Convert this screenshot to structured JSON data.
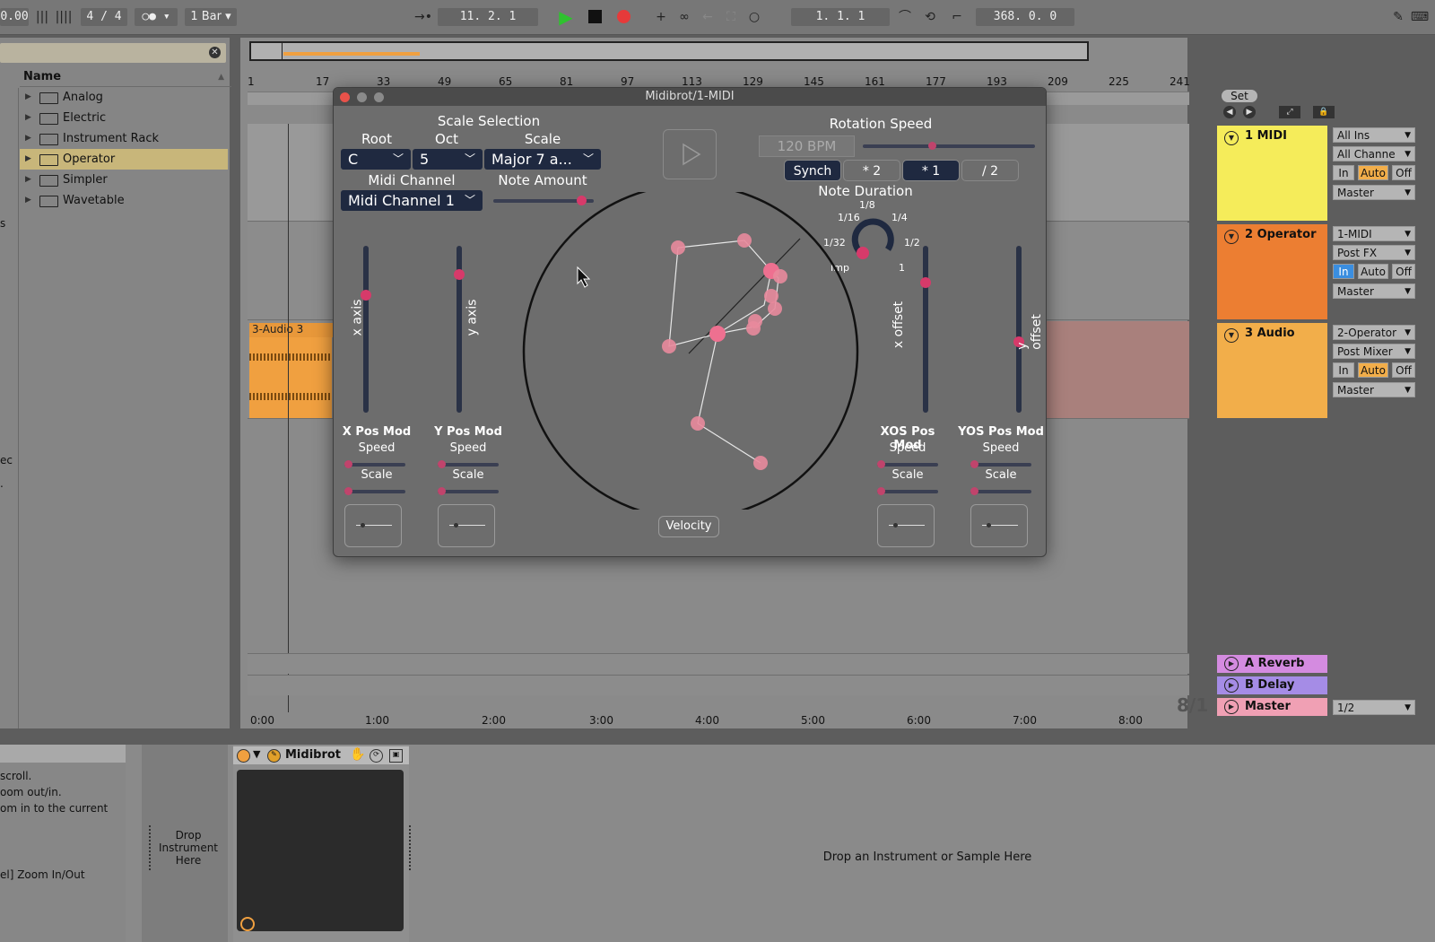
{
  "transport": {
    "tempo_fragment": "0.00",
    "signature": "4 / 4",
    "quantize": "1 Bar",
    "arrangement_position": "11.  2.  1",
    "loop_start": "1.  1.  1",
    "loop_length": "368.  0.  0"
  },
  "browser": {
    "header": "Name",
    "items": [
      {
        "label": "Analog"
      },
      {
        "label": "Electric"
      },
      {
        "label": "Instrument Rack"
      },
      {
        "label": "Operator"
      },
      {
        "label": "Simpler"
      },
      {
        "label": "Wavetable"
      }
    ],
    "side_fragments": [
      "s",
      "ec",
      "."
    ]
  },
  "ruler": {
    "bars": [
      "1",
      "17",
      "33",
      "49",
      "65",
      "81",
      "97",
      "113",
      "129",
      "145",
      "161",
      "177",
      "193",
      "209",
      "225",
      "241"
    ],
    "times": [
      "0:00",
      "1:00",
      "2:00",
      "3:00",
      "4:00",
      "5:00",
      "6:00",
      "7:00",
      "8:00"
    ],
    "zoom_fraction": "8/1"
  },
  "clip": {
    "name": "3-Audio 3"
  },
  "plugin": {
    "title": "Midibrot/1-MIDI",
    "scale_selection": "Scale Selection",
    "root_label": "Root",
    "oct_label": "Oct",
    "scale_label": "Scale",
    "root_value": "C",
    "oct_value": "5",
    "scale_value": "Major 7 a...",
    "midi_channel_label": "Midi Channel",
    "midi_channel_value": "Midi Channel 1",
    "note_amount_label": "Note Amount",
    "note_amount": 0.92,
    "rotation_speed_label": "Rotation Speed",
    "bpm": "120 BPM",
    "rotation_speed": 0.4,
    "rate_buttons": [
      "Synch",
      "* 2",
      "* 1",
      "/ 2"
    ],
    "note_duration_label": "Note Duration",
    "dur_labels": {
      "d8": "1/8",
      "d16": "1/16",
      "d4": "1/4",
      "d32": "1/32",
      "d2": "1/2",
      "imp": "Imp",
      "one": "1"
    },
    "x_axis": "x axis",
    "y_axis": "y axis",
    "x_offset": "x offset",
    "y_offset": "y offset",
    "x_axis_level": 0.72,
    "y_axis_level": 0.85,
    "x_offset_level": 0.8,
    "y_offset_level": 0.42,
    "mods": [
      {
        "title": "X Pos Mod",
        "speed": "Speed",
        "scale": "Scale"
      },
      {
        "title": "Y Pos Mod",
        "speed": "Speed",
        "scale": "Scale"
      },
      {
        "title": "XOS Pos Mod",
        "speed": "Speed",
        "scale": "Scale"
      },
      {
        "title": "YOS Pos Mod",
        "speed": "Speed",
        "scale": "Scale"
      }
    ],
    "velocity": "Velocity"
  },
  "mixer": {
    "set_label": "Set",
    "tracks": [
      {
        "name": "1 MIDI",
        "color": "#f5ec5a",
        "io": [
          "All Ins",
          "All Channe",
          "Master"
        ]
      },
      {
        "name": "2 Operator",
        "color": "#ec7e32",
        "io": [
          "1-MIDI",
          "Post FX",
          "Master"
        ]
      },
      {
        "name": "3 Audio",
        "color": "#f2ae4a",
        "io": [
          "2-Operator",
          "Post Mixer",
          "Master"
        ]
      }
    ],
    "monitor": [
      "In",
      "Auto",
      "Off"
    ],
    "returns": [
      {
        "name": "A Reverb",
        "color": "#d48be0"
      },
      {
        "name": "B Delay",
        "color": "#a58ce6"
      },
      {
        "name": "Master",
        "color": "#f0a0b4",
        "io": "1/2"
      }
    ]
  },
  "device": {
    "name": "Midibrot",
    "drop_rack": "Drop Instrument Here",
    "drop_main": "Drop an Instrument or Sample Here",
    "help_lines": [
      "scroll.",
      "oom out/in.",
      "om in to the current",
      "el] Zoom In/Out"
    ]
  },
  "colors": {
    "accent_pink": "#d63a6a",
    "clip_orange": "#f0a040",
    "browser_selected": "#c8b67a"
  }
}
